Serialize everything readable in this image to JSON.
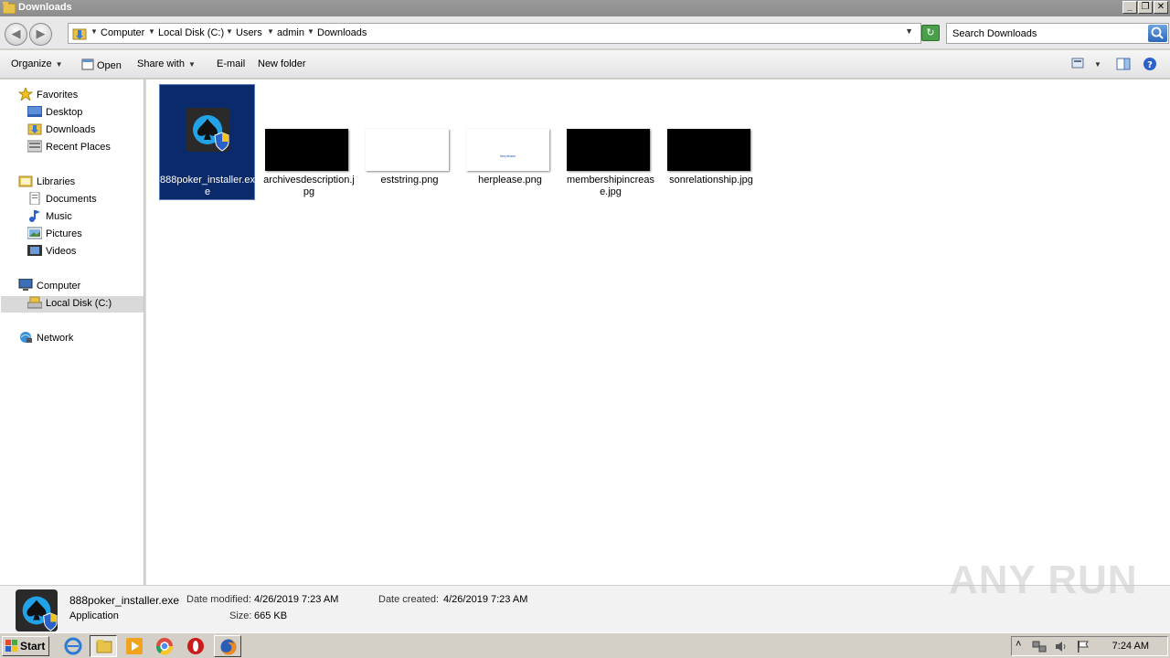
{
  "window": {
    "title": "Downloads",
    "controls": {
      "minimize": "_",
      "restore": "❐",
      "close": "✕"
    }
  },
  "address": {
    "breadcrumbs": [
      "Computer",
      "Local Disk (C:)",
      "Users",
      "admin",
      "Downloads"
    ]
  },
  "search": {
    "placeholder": "Search Downloads"
  },
  "toolbar": {
    "organize": "Organize",
    "open": "Open",
    "share_with": "Share with",
    "email": "E-mail",
    "new_folder": "New folder"
  },
  "nav": {
    "favorites": "Favorites",
    "desktop": "Desktop",
    "downloads": "Downloads",
    "recent_places": "Recent Places",
    "libraries": "Libraries",
    "documents": "Documents",
    "music": "Music",
    "pictures": "Pictures",
    "videos": "Videos",
    "computer": "Computer",
    "local_disk": "Local Disk (C:)",
    "network": "Network"
  },
  "files": [
    {
      "name": "888poker_installer.exe",
      "type": "exe",
      "selected": true
    },
    {
      "name": "archivesdescription.jpg",
      "type": "dark"
    },
    {
      "name": "eststring.png",
      "type": "light"
    },
    {
      "name": "herplease.png",
      "type": "light",
      "thumb_text": "herplease"
    },
    {
      "name": "membershipincrease.jpg",
      "type": "dark"
    },
    {
      "name": "sonrelationship.jpg",
      "type": "dark"
    }
  ],
  "details": {
    "filename": "888poker_installer.exe",
    "filetype": "Application",
    "date_modified_label": "Date modified:",
    "date_modified": "4/26/2019 7:23 AM",
    "size_label": "Size:",
    "size": "665 KB",
    "date_created_label": "Date created:",
    "date_created": "4/26/2019 7:23 AM"
  },
  "taskbar": {
    "start": "Start",
    "clock": "7:24 AM"
  },
  "watermark": "ANY RUN",
  "colors": {
    "selection": "#0b2a6b",
    "titlebar": "#9a9a9a",
    "taskbar": "#d4d0c8"
  }
}
